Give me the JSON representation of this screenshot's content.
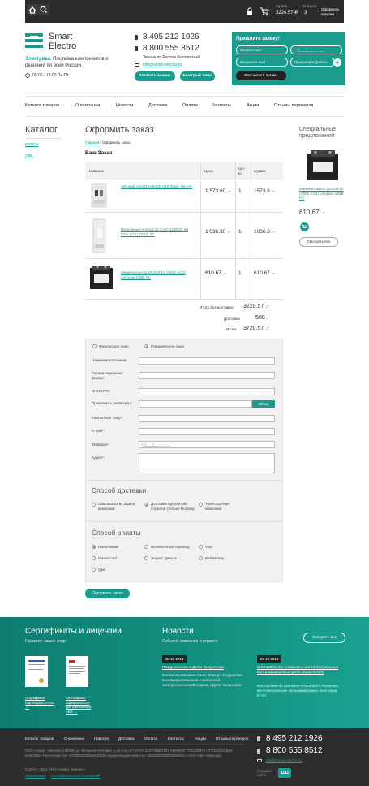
{
  "top": {
    "sum_label": "Сумма",
    "sum_value": "3220.57 ₽",
    "goods_label": "Товаров",
    "goods_value": "3",
    "checkout": "Оформить покупки"
  },
  "header": {
    "logo_line1": "Smart",
    "logo_line2": "Electro",
    "tagline_accent": "Электрика.",
    "tagline": "Поставка компонентов и решений по всей России.",
    "hours": "09:00 - 18:00  Пн-Пт",
    "phone1": "8 495 212 1926",
    "phone2": "8 800 555 8512",
    "free_call": "Звонок по России бесплатный",
    "email": "info@smart-electro.ru",
    "order_call": "Заказать звонок",
    "quick_order": "Быстрый заказ"
  },
  "request": {
    "title": "Пришлите заявку!",
    "name_ph": "Введите имя",
    "phone_ph": "+7(___)___-__-__",
    "email_ph": "Введите e-mail",
    "file_ph": "Прикрепите файлы",
    "submit": "Рассчитать проект"
  },
  "nav": [
    "Каталог товаров",
    "О компании",
    "Новости",
    "Доставка",
    "Оплата",
    "Контакты",
    "Акции",
    "Отзывы партнеров"
  ],
  "sidebar": {
    "title": "Каталог",
    "items": [
      "EATON",
      "ABB"
    ]
  },
  "page": {
    "title": "Оформить заказ",
    "crumb_home": "Главная",
    "crumb_current": "/ Оформить заказ",
    "cart_title": "Ваш Заказ"
  },
  "table": {
    "headers": [
      "Название",
      "Цена",
      "Кол-во",
      "Сумма"
    ],
    "rows": [
      {
        "name": "Авт.диф.тока DSH941R C16 30мА тип AC",
        "price": "1 573.60 .-",
        "qty": "1",
        "sum": "1573.6 .-"
      },
      {
        "name": "Модульный контактор Z-SCH230/25-40 (25A AC1) 220 В AC",
        "price": "1 036.30 .-",
        "qty": "1",
        "sum": "1036.3 .-"
      },
      {
        "name": "Миниконтактор DILEM-10 (400В AC3) катушка 230В AC",
        "price": "610.67 .-",
        "qty": "1",
        "sum": "610.67 .-"
      }
    ]
  },
  "totals": {
    "no_delivery_label": "Итого без доставки:",
    "no_delivery": "3220.57 .-",
    "delivery_label": "Доставка",
    "delivery": "500 .-",
    "total_label": "Итого:",
    "total": "3720.57 .-"
  },
  "form": {
    "person": "Физическое лицо",
    "company": "Юридическое лицо",
    "company_name": "Название компании:",
    "org_form": "Организационная форма:",
    "inn": "ИНН/КПП:",
    "attach": "Прикрепить реквизиты:",
    "browse": "Обзор",
    "contact": "Контактное лицо*:",
    "email": "E-mail*:",
    "phone": "Телефон*:",
    "phone_ph": "+_(___)___-__-__",
    "address": "Адрес*:"
  },
  "delivery": {
    "title": "Способ доставки",
    "opt1": "Самовывоз из офиса компании",
    "opt2": "Доставка курьерской службой (только Москва)",
    "opt3": "Транспортная компания"
  },
  "payment": {
    "title": "Способ оплаты",
    "opts": [
      "Наличными",
      "Безналичный перевод",
      "Visa",
      "Mastercard",
      "Яндекс Деньги",
      "WebMoney",
      "Qiwi"
    ]
  },
  "checkout_btn": "Оформить заказ",
  "special": {
    "title": "Специальные предложения",
    "name": "Миниконтактор DILEM-10 (400В AC3) катушка 230В AC",
    "price": "610,67 .-",
    "view_all": "Смотреть все"
  },
  "certs": {
    "title": "Сертификаты и лицензии",
    "sub": "Гарантия наших услуг",
    "c1": "Сертификат партнера EATON →",
    "c2": "Сертификат официального дистрибьютора ABB →"
  },
  "news": {
    "title": "Новости",
    "sub": "События компании и отрасли",
    "all": "Смотреть все",
    "items": [
      {
        "date": "30-12-2013",
        "title": "Поздравление с Днём Энергетика",
        "text": "Коллектив компании Смарт Электро поздравляет всех профессионалов и любителей электротехнической отрасли с Днём Энергетика!"
      },
      {
        "date": "06-10-2013",
        "title": "В SmartElectro появились интеллектуальные программируемые реле серии EASY.",
        "text": "В ассортименте компании SmartElectro появились интеллектуальные программируемые реле серии EASY."
      }
    ]
  },
  "footer": {
    "nav": [
      "Каталог товаров",
      "О компании",
      "Новости",
      "Доставка",
      "Оплата",
      "Контакты",
      "Акции",
      "Отзывы партнеров"
    ],
    "phone1": "8 495 212 1926",
    "phone2": "8 800 555 8512",
    "email": "info@smart-electro.ru",
    "address": "ООО «Смарт Электро» 109390, ул. Большая Почтовая, д.36, стр. 6-7 ОГРН 1117746927297 ИНН/КПП 7701309870 / 770101001 БИК 044525201 Расчетный счет 40702810800000003026 Корреспондентский счет 30101810300000000201 в ОАО АКБ \"Авангард\"",
    "copyright": "© 2013 – 2014 ООО «Смарт Электро»",
    "info": "Информация",
    "agreement": "Пользовательское соглашение",
    "made_by": "Создание сайта",
    "badge": "1111"
  }
}
